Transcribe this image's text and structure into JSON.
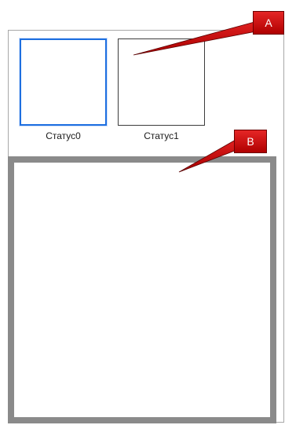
{
  "thumbnails": [
    {
      "label": "Статус0",
      "selected": true
    },
    {
      "label": "Статус1",
      "selected": false
    }
  ],
  "callouts": {
    "a": {
      "letter": "A"
    },
    "b": {
      "letter": "B"
    }
  },
  "colors": {
    "selected_border": "#1e6fe0",
    "callout_fill": "#cc1111",
    "preview_border": "#8a8a8a"
  }
}
